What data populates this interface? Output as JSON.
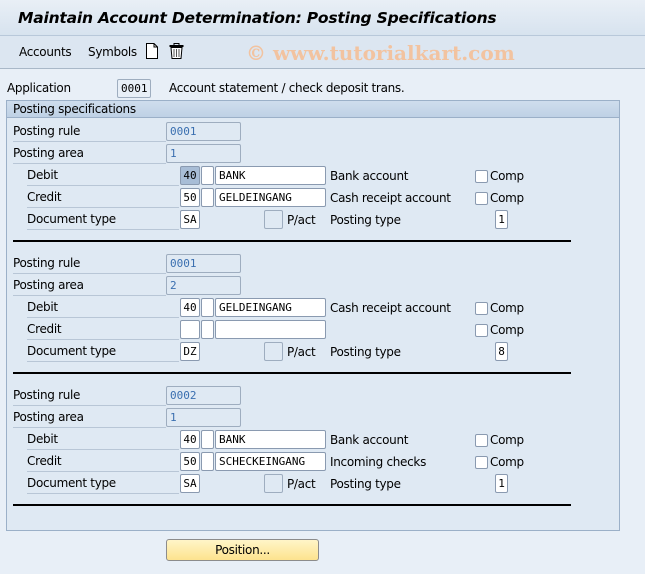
{
  "window": {
    "title": "Maintain Account Determination: Posting Specifications"
  },
  "toolbar": {
    "menu_items": [
      {
        "label": "Accounts"
      },
      {
        "label": "Symbols"
      }
    ],
    "icons": [
      "new-document-icon",
      "delete-trash-icon"
    ],
    "watermark": "© www.tutorialkart.com"
  },
  "application": {
    "label": "Application",
    "value": "0001",
    "description": "Account statement / check deposit trans."
  },
  "group": {
    "title": "Posting specifications"
  },
  "labels": {
    "posting_rule": "Posting rule",
    "posting_area": "Posting area",
    "debit": "Debit",
    "credit": "Credit",
    "document_type": "Document type",
    "pact": "P/act",
    "posting_type": "Posting type",
    "comp": "Comp"
  },
  "specifications": [
    {
      "posting_rule": "0001",
      "posting_area": "1",
      "debit": {
        "posting_key": "40",
        "special_gl": "",
        "account_symbol": "BANK",
        "account_text": "Bank account",
        "comp": false
      },
      "credit": {
        "posting_key": "50",
        "special_gl": "",
        "account_symbol": "GELDEINGANG",
        "account_text": "Cash receipt account",
        "comp": false
      },
      "document_type": "SA",
      "pact": false,
      "posting_type": "1"
    },
    {
      "posting_rule": "0001",
      "posting_area": "2",
      "debit": {
        "posting_key": "40",
        "special_gl": "",
        "account_symbol": "GELDEINGANG",
        "account_text": "Cash receipt account",
        "comp": false
      },
      "credit": {
        "posting_key": "",
        "special_gl": "",
        "account_symbol": "",
        "account_text": "",
        "comp": false
      },
      "document_type": "DZ",
      "pact": false,
      "posting_type": "8"
    },
    {
      "posting_rule": "0002",
      "posting_area": "1",
      "debit": {
        "posting_key": "40",
        "special_gl": "",
        "account_symbol": "BANK",
        "account_text": "Bank account",
        "comp": false
      },
      "credit": {
        "posting_key": "50",
        "special_gl": "",
        "account_symbol": "SCHECKEINGANG",
        "account_text": "Incoming checks",
        "comp": false
      },
      "document_type": "SA",
      "pact": false,
      "posting_type": "1"
    }
  ],
  "buttons": {
    "position": "Position..."
  },
  "colors": {
    "background": "#e8eff7",
    "group_background": "#dfe9f3",
    "readonly_text": "#3a6fb0",
    "button_yellow": "#fde38e",
    "watermark": "#f2c3a0"
  }
}
